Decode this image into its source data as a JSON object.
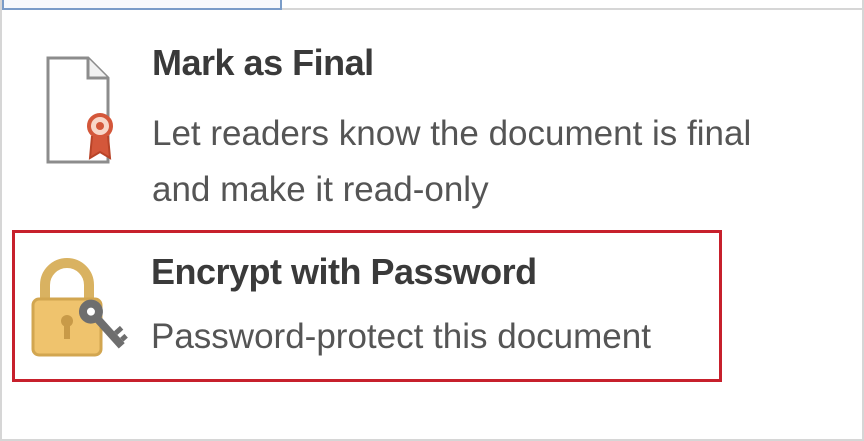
{
  "menu": {
    "items": [
      {
        "icon": "document-ribbon-icon",
        "title": "Mark as Final",
        "description": "Let readers know the document is final and make it read-only"
      },
      {
        "icon": "lock-key-icon",
        "title": "Encrypt with Password",
        "description": "Password-protect this document",
        "highlight_color": "#c7202c"
      }
    ]
  }
}
